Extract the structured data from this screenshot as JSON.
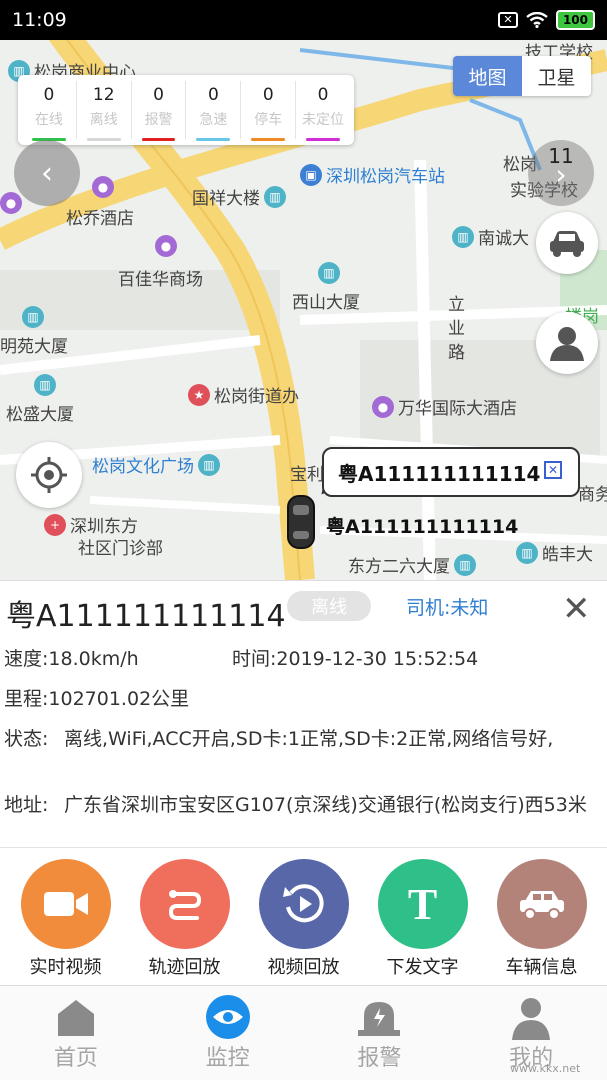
{
  "status_bar": {
    "time": "11:09",
    "battery": "100"
  },
  "map": {
    "pois": [
      "松岗商业中心",
      "技工学校",
      "深圳松岗汽车站",
      "国祥大楼",
      "松岗",
      "实验学校",
      "松乔酒店",
      "南诚大",
      "百佳华商场",
      "西山大厦",
      "立",
      "业",
      "路",
      "明苑大厦",
      "松盛大厦",
      "松岗街道办",
      "万华国际大酒店",
      "松岗文化广场",
      "宝利",
      "商务",
      "深圳东方",
      "社区门诊部",
      "东方二六大厦",
      "皓丰大",
      "楼岗"
    ],
    "type_toggle": {
      "map": "地图",
      "satellite": "卫星"
    },
    "right_counter": "11",
    "popup_plate": "粤A111111111114",
    "marker_plate": "粤A111111111114"
  },
  "counts": [
    {
      "value": "0",
      "label": "在线",
      "color": "#2ec24b"
    },
    {
      "value": "12",
      "label": "离线",
      "color": "#d6d6d6"
    },
    {
      "value": "0",
      "label": "报警",
      "color": "#e02020"
    },
    {
      "value": "0",
      "label": "急速",
      "color": "#66c7e6"
    },
    {
      "value": "0",
      "label": "停车",
      "color": "#f08a24"
    },
    {
      "value": "0",
      "label": "未定位",
      "color": "#d22cd9"
    }
  ],
  "vehicle": {
    "plate": "粤A111111111114",
    "status_badge": "离线",
    "driver": "司机:未知",
    "speed_label": "速度:",
    "speed": "18.0km/h",
    "time_label": "时间:",
    "time": "2019-12-30 15:52:54",
    "mileage_label": "里程:",
    "mileage": "102701.02公里",
    "state_label": "状态:",
    "state": "离线,WiFi,ACC开启,SD卡:1正常,SD卡:2正常,网络信号好,",
    "address_label": "地址:",
    "address": "广东省深圳市宝安区G107(京深线)交通银行(松岗支行)西53米"
  },
  "actions": [
    {
      "label": "实时视频",
      "color": "#f08c3c"
    },
    {
      "label": "轨迹回放",
      "color": "#ef6f5c"
    },
    {
      "label": "视频回放",
      "color": "#5867a8"
    },
    {
      "label": "下发文字",
      "color": "#2fbf89"
    },
    {
      "label": "车辆信息",
      "color": "#b3837a"
    }
  ],
  "tabs": [
    {
      "label": "首页"
    },
    {
      "label": "监控"
    },
    {
      "label": "报警"
    },
    {
      "label": "我的"
    }
  ],
  "watermark": "www.kkx.net"
}
